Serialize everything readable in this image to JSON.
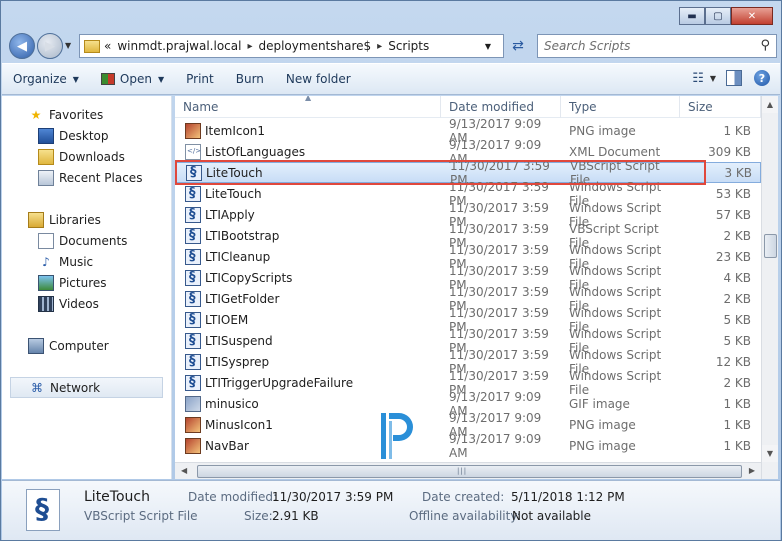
{
  "window": {
    "buttons": {
      "minimize": "▬",
      "maximize": "▢",
      "close": "✕"
    }
  },
  "address": {
    "overflow": "«",
    "crumbs": [
      "winmdt.prajwal.local",
      "deploymentshare$",
      "Scripts"
    ],
    "separator": "▸"
  },
  "search": {
    "placeholder": "Search Scripts"
  },
  "toolbar": {
    "organize": "Organize",
    "open": "Open",
    "print": "Print",
    "burn": "Burn",
    "new_folder": "New folder",
    "help": "?"
  },
  "nav": {
    "favorites": {
      "label": "Favorites",
      "items": [
        "Desktop",
        "Downloads",
        "Recent Places"
      ]
    },
    "libraries": {
      "label": "Libraries",
      "items": [
        "Documents",
        "Music",
        "Pictures",
        "Videos"
      ]
    },
    "computer": "Computer",
    "network": "Network"
  },
  "columns": {
    "name": "Name",
    "date": "Date modified",
    "type": "Type",
    "size": "Size"
  },
  "files": [
    {
      "name": "ItemIcon1",
      "date": "9/13/2017 9:09 AM",
      "type": "PNG image",
      "size": "1 KB",
      "icon": "png"
    },
    {
      "name": "ListOfLanguages",
      "date": "9/13/2017 9:09 AM",
      "type": "XML Document",
      "size": "309 KB",
      "icon": "xml"
    },
    {
      "name": "LiteTouch",
      "date": "11/30/2017 3:59 PM",
      "type": "VBScript Script File",
      "size": "3 KB",
      "icon": "vbs",
      "selected": true
    },
    {
      "name": "LiteTouch",
      "date": "11/30/2017 3:59 PM",
      "type": "Windows Script File",
      "size": "53 KB",
      "icon": "vbs"
    },
    {
      "name": "LTIApply",
      "date": "11/30/2017 3:59 PM",
      "type": "Windows Script File",
      "size": "57 KB",
      "icon": "vbs"
    },
    {
      "name": "LTIBootstrap",
      "date": "11/30/2017 3:59 PM",
      "type": "VBScript Script File",
      "size": "2 KB",
      "icon": "vbs"
    },
    {
      "name": "LTICleanup",
      "date": "11/30/2017 3:59 PM",
      "type": "Windows Script File",
      "size": "23 KB",
      "icon": "vbs"
    },
    {
      "name": "LTICopyScripts",
      "date": "11/30/2017 3:59 PM",
      "type": "Windows Script File",
      "size": "4 KB",
      "icon": "vbs"
    },
    {
      "name": "LTIGetFolder",
      "date": "11/30/2017 3:59 PM",
      "type": "Windows Script File",
      "size": "2 KB",
      "icon": "vbs"
    },
    {
      "name": "LTIOEM",
      "date": "11/30/2017 3:59 PM",
      "type": "Windows Script File",
      "size": "5 KB",
      "icon": "vbs"
    },
    {
      "name": "LTISuspend",
      "date": "11/30/2017 3:59 PM",
      "type": "Windows Script File",
      "size": "5 KB",
      "icon": "vbs"
    },
    {
      "name": "LTISysprep",
      "date": "11/30/2017 3:59 PM",
      "type": "Windows Script File",
      "size": "12 KB",
      "icon": "vbs"
    },
    {
      "name": "LTITriggerUpgradeFailure",
      "date": "11/30/2017 3:59 PM",
      "type": "Windows Script File",
      "size": "2 KB",
      "icon": "vbs"
    },
    {
      "name": "minusico",
      "date": "9/13/2017 9:09 AM",
      "type": "GIF image",
      "size": "1 KB",
      "icon": "gif"
    },
    {
      "name": "MinusIcon1",
      "date": "9/13/2017 9:09 AM",
      "type": "PNG image",
      "size": "1 KB",
      "icon": "png"
    },
    {
      "name": "NavBar",
      "date": "9/13/2017 9:09 AM",
      "type": "PNG image",
      "size": "1 KB",
      "icon": "png"
    }
  ],
  "details": {
    "name": "LiteTouch",
    "type": "VBScript Script File",
    "date_modified_label": "Date modified:",
    "date_modified": "11/30/2017 3:59 PM",
    "size_label": "Size:",
    "size": "2.91 KB",
    "date_created_label": "Date created:",
    "date_created": "5/11/2018 1:12 PM",
    "offline_label": "Offline availability:",
    "offline": "Not available"
  },
  "colors": {
    "highlight_border": "#e0483c",
    "selection": "#c8ddf6",
    "watermark": "#2a8fd8"
  }
}
